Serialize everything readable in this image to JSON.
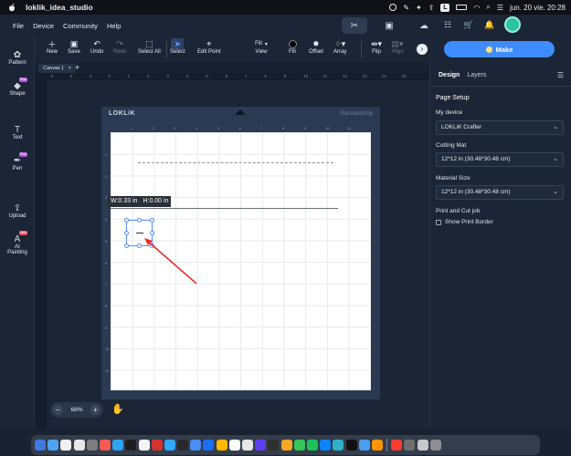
{
  "menubar": {
    "app_name": "loklik_idea_studio",
    "date_time": "jun. 20 vie. 20:28",
    "tray_box": "L"
  },
  "app_menu": {
    "items": [
      "File",
      "Device",
      "Community",
      "Help"
    ]
  },
  "toolbar": {
    "new": "New",
    "save": "Save",
    "undo": "Undo",
    "redo": "Redo",
    "select_all": "Select All",
    "select": "Select",
    "edit_point": "Edit Point",
    "fill_dropdown": "Fill",
    "view": "View",
    "fill": "Fill",
    "offset": "Offset",
    "array": "Array",
    "flip": "Flip",
    "align": "Align",
    "more": "›"
  },
  "make_button": "Make",
  "sidebar": {
    "items": [
      {
        "label": "Pattern",
        "icon": "pattern-icon"
      },
      {
        "label": "Shape",
        "icon": "shape-icon",
        "badge": "Plus"
      },
      {
        "label": "Text",
        "icon": "text-icon"
      },
      {
        "label": "Pen",
        "icon": "pen-icon",
        "badge": "Plus"
      },
      {
        "label": "Upload",
        "icon": "upload-icon"
      },
      {
        "label": "AI Painting",
        "label_line1": "AI",
        "label_line2": "Painting",
        "icon": "ai-painting-icon",
        "badge": "New"
      }
    ]
  },
  "canvas_tabs": {
    "active": "Canvas 1",
    "close": "×",
    "add": "+"
  },
  "ruler_top_labels": [
    "-3",
    "-2",
    "-1",
    "0",
    "1",
    "2",
    "3",
    "4",
    "5",
    "6",
    "7",
    "8",
    "9",
    "10",
    "11",
    "12",
    "13",
    "14",
    "15"
  ],
  "mat": {
    "brand": "LOKLiK",
    "grip": "StandardGrip"
  },
  "mat_ruler_x": [
    "1",
    "2",
    "3",
    "4",
    "5",
    "6",
    "7",
    "8",
    "9",
    "10",
    "11"
  ],
  "mat_ruler_y": [
    "1",
    "2",
    "3",
    "4",
    "5",
    "6",
    "7",
    "8",
    "9",
    "10",
    "11"
  ],
  "dimension_tooltip": {
    "width": "W:0.33 in",
    "height": "H:0.00 in"
  },
  "zoom": {
    "minus": "−",
    "value": "68%",
    "plus": "+"
  },
  "right_panel": {
    "tab_design": "Design",
    "tab_layers": "Layers",
    "page_setup": "Page Setup",
    "my_device_label": "My device",
    "my_device_value": "LOKLiK Crafter",
    "cutting_mat_label": "Cutting Mat",
    "cutting_mat_value": "12*12 in (30.48*30.48 cm)",
    "material_size_label": "Material Size",
    "material_size_value": "12*12 in (30.48*30.48 cm)",
    "print_cut_label": "Print and Cut job",
    "show_print_border": "Show Print Border"
  },
  "colors": {
    "accent": "#3f8cff",
    "bg": "#1b2536",
    "annotation_arrow": "#e52b2b"
  }
}
